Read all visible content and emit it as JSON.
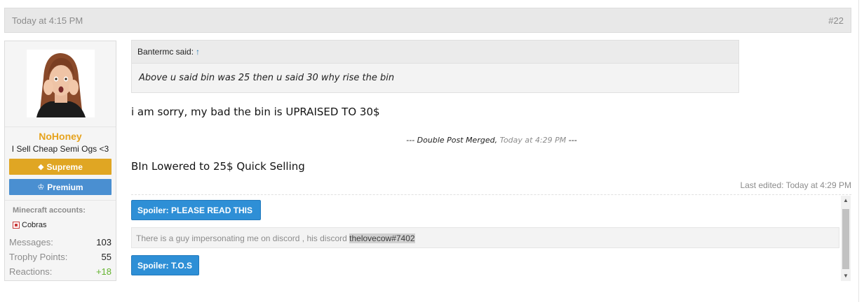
{
  "post": {
    "date": "Today at 4:15 PM",
    "number": "#22"
  },
  "user": {
    "name": "NoHoney",
    "title": "I Sell Cheap Semi Ogs <3",
    "banners": {
      "supreme": "Supreme",
      "premium": "Premium"
    },
    "minecraft_label": "Minecraft accounts:",
    "minecraft_item": "Cobras",
    "stats": [
      {
        "label": "Messages:",
        "value": "103"
      },
      {
        "label": "Trophy Points:",
        "value": "55"
      },
      {
        "label": "Reactions:",
        "value": "+18"
      }
    ]
  },
  "quote": {
    "author": "Bantermc said:",
    "arrow": "↑",
    "text": "Above u said bin was 25 then u said 30 why rise the bin"
  },
  "message": {
    "line1": "i am sorry, my bad the bin is UPRAISED TO 30$",
    "merged_prefix": "--- Double Post Merged,",
    "merged_time": "Today at 4:29 PM",
    "merged_suffix": "---",
    "line2": "BIn Lowered to 25$ Quick Selling",
    "last_edited": "Last edited: Today at 4:29 PM"
  },
  "signature": {
    "spoiler1": "Spoiler: PLEASE READ THIS",
    "notice_text": "There is a guy impersonating me on discord , his discord",
    "notice_handle": "thelovecow#7402",
    "spoiler2": "Spoiler: T.O.S"
  },
  "colors": {
    "username": "#e6a31e",
    "supreme": "#e0a623",
    "premium": "#4a8fd1",
    "spoiler": "#2e8fd6",
    "reactions_positive": "#63b32e"
  },
  "icons": {
    "supreme": "diamond-icon",
    "premium": "trophy-icon",
    "minecraft": "minecraft-icon"
  }
}
